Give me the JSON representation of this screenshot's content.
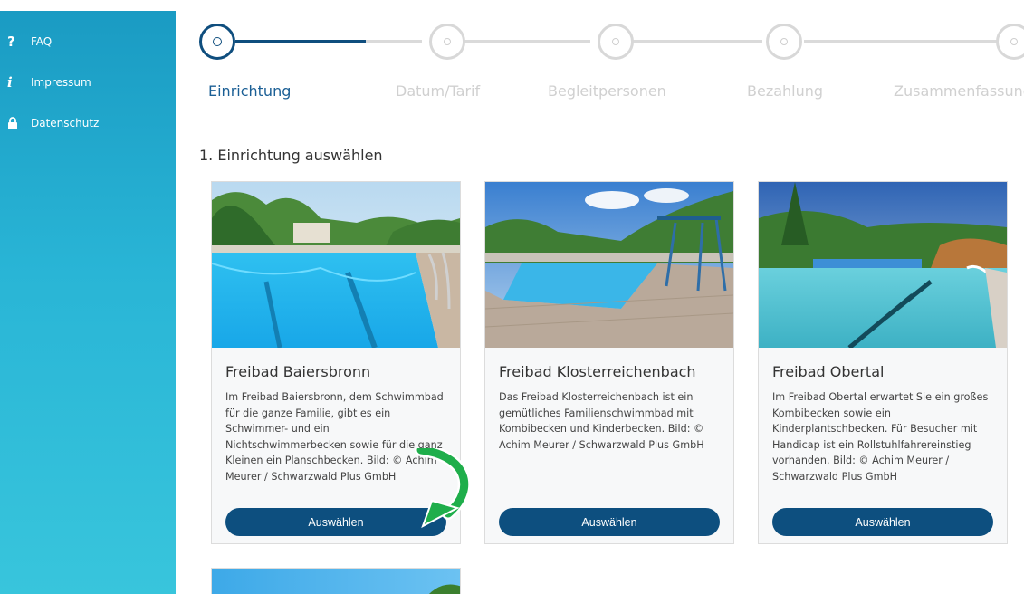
{
  "sidebar": {
    "items": [
      {
        "label": "FAQ",
        "icon": "question-icon"
      },
      {
        "label": "Impressum",
        "icon": "info-icon"
      },
      {
        "label": "Datenschutz",
        "icon": "lock-icon"
      }
    ]
  },
  "stepper": {
    "steps": [
      {
        "label": "Einrichtung",
        "active": true
      },
      {
        "label": "Datum/Tarif",
        "active": false
      },
      {
        "label": "Begleitpersonen",
        "active": false
      },
      {
        "label": "Bezahlung",
        "active": false
      },
      {
        "label": "Zusammenfassung",
        "active": false
      }
    ]
  },
  "section": {
    "title": "1. Einrichtung auswählen"
  },
  "cards": [
    {
      "title": "Freibad Baiersbronn",
      "description": "Im Freibad Baiersbronn, dem Schwimmbad für die ganze Familie, gibt es ein Schwimmer- und ein Nichtschwimmerbecken sowie für die ganz Kleinen ein Planschbecken. Bild: © Achim Meurer / Schwarzwald Plus GmbH",
      "button": "Auswählen"
    },
    {
      "title": "Freibad Klosterreichenbach",
      "description": "Das Freibad Klosterreichenbach ist ein gemütliches Familienschwimmbad mit Kombibecken und Kinderbecken. Bild: © Achim Meurer / Schwarzwald Plus GmbH",
      "button": "Auswählen"
    },
    {
      "title": "Freibad Obertal",
      "description": "Im Freibad Obertal erwartet Sie ein großes Kombibecken sowie ein Kinderplantschbecken. Für Besucher mit Handicap ist ein Rollstuhlfahrereinstieg vorhanden. Bild: © Achim Meurer / Schwarzwald Plus GmbH",
      "button": "Auswählen"
    }
  ],
  "colors": {
    "primary": "#0d4f7f",
    "sidebar_top": "#1a9bc3",
    "sidebar_bottom": "#38c5dc",
    "arrow": "#1fae4b"
  }
}
